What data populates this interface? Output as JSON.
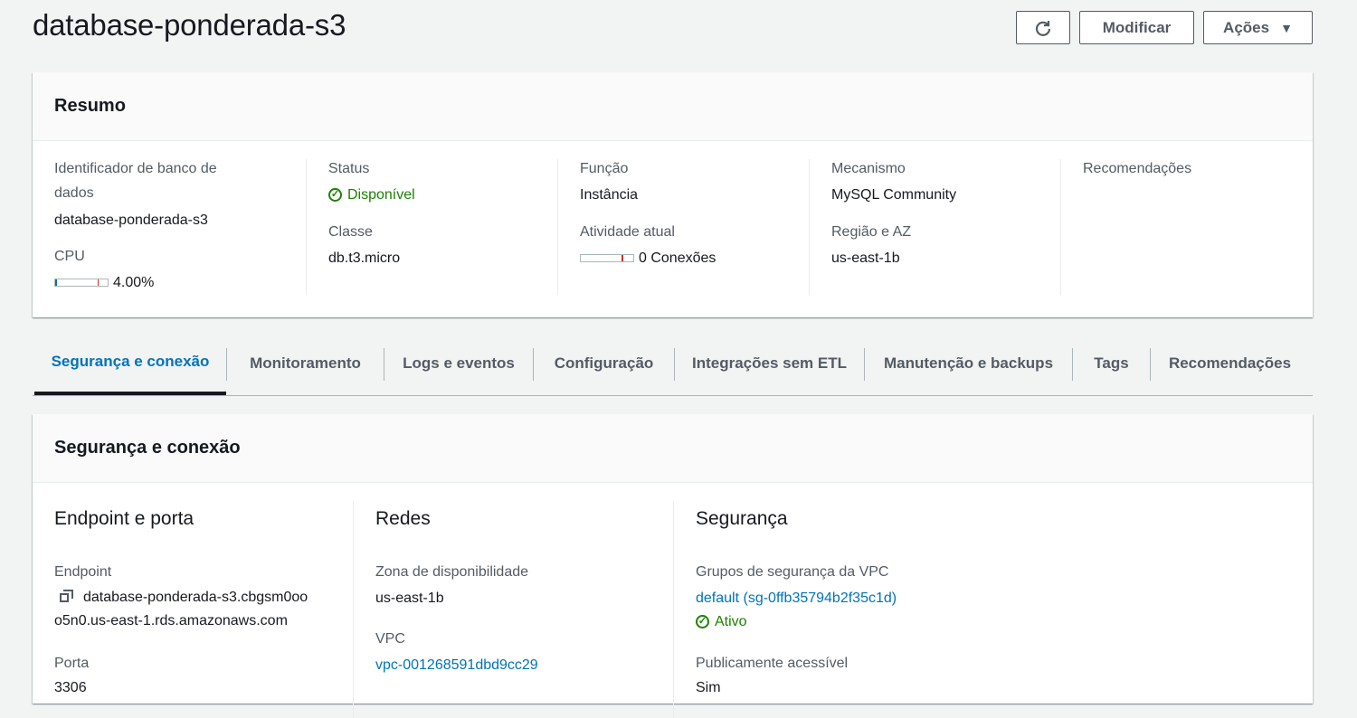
{
  "header": {
    "title": "database-ponderada-s3",
    "refresh_icon": "refresh-icon",
    "modify_label": "Modificar",
    "actions_label": "Ações",
    "actions_caret": "▼"
  },
  "summary": {
    "title": "Resumo",
    "db_identifier_label": "Identificador de banco de dados",
    "db_identifier_value": "database-ponderada-s3",
    "cpu_label": "CPU",
    "cpu_value": "4.00%",
    "cpu_percent": 4.0,
    "status_label": "Status",
    "status_value": "Disponível",
    "class_label": "Classe",
    "class_value": "db.t3.micro",
    "role_label": "Função",
    "role_value": "Instância",
    "activity_label": "Atividade atual",
    "activity_value": "0 Conexões",
    "engine_label": "Mecanismo",
    "engine_value": "MySQL Community",
    "region_label": "Região e AZ",
    "region_value": "us-east-1b",
    "recommendations_label": "Recomendações"
  },
  "tabs": [
    {
      "label": "Segurança e conexão",
      "active": true
    },
    {
      "label": "Monitoramento"
    },
    {
      "label": "Logs e eventos"
    },
    {
      "label": "Configuração"
    },
    {
      "label": "Integrações sem ETL"
    },
    {
      "label": "Manutenção e backups"
    },
    {
      "label": "Tags"
    },
    {
      "label": "Recomendações"
    }
  ],
  "security": {
    "title": "Segurança e conexão",
    "endpoint_heading": "Endpoint e porta",
    "endpoint_label": "Endpoint",
    "endpoint_line1": "database-ponderada-s3.cbgsm0oo",
    "endpoint_line2": "o5n0.us-east-1.rds.amazonaws.com",
    "port_label": "Porta",
    "port_value": "3306",
    "network_heading": "Redes",
    "az_label": "Zona de disponibilidade",
    "az_value": "us-east-1b",
    "vpc_label": "VPC",
    "vpc_value": "vpc-001268591dbd9cc29",
    "sec_heading": "Segurança",
    "sg_label": "Grupos de segurança da VPC",
    "sg_value": "default (sg-0ffb35794b2f35c1d)",
    "sg_status": "Ativo",
    "public_label": "Publicamente acessível",
    "public_value": "Sim"
  },
  "colors": {
    "accent": "#0073bb",
    "success": "#1d8102",
    "background": "#f2f3f3"
  }
}
